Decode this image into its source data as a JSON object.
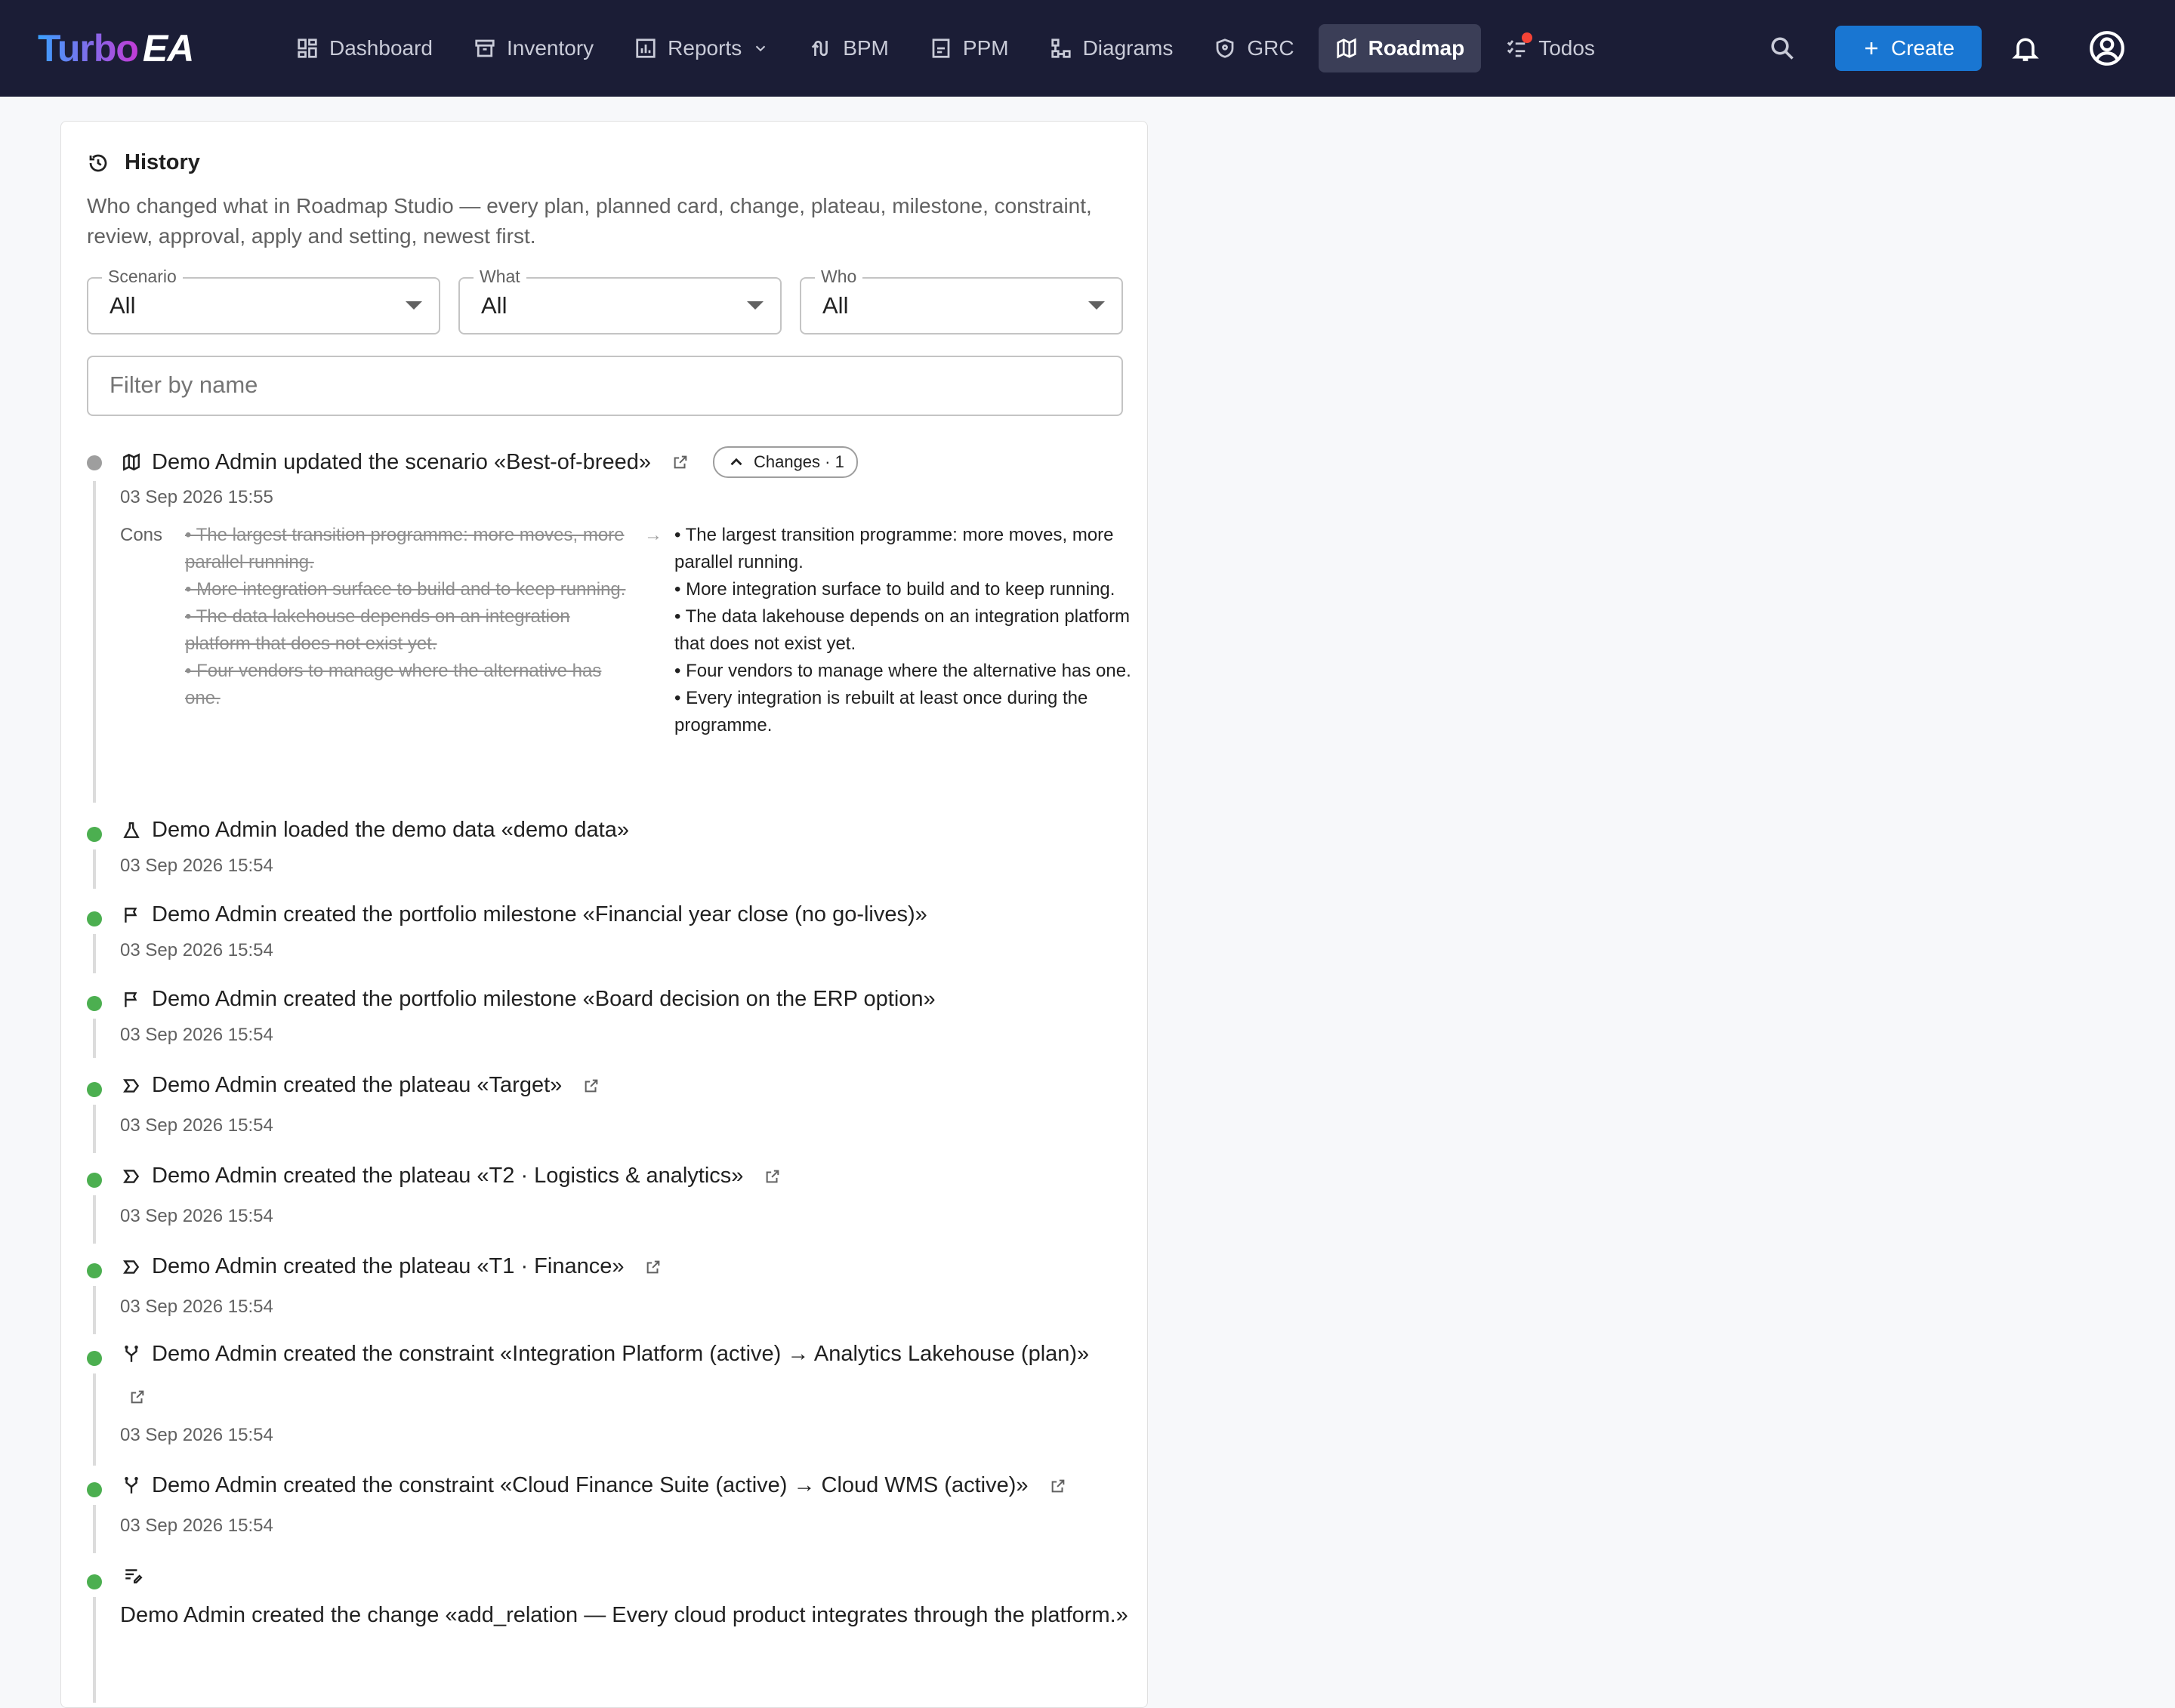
{
  "app": {
    "logo_turbo": "Turbo",
    "logo_ea": "EA"
  },
  "nav": [
    {
      "label": "Dashboard",
      "icon": "dashboard-icon"
    },
    {
      "label": "Inventory",
      "icon": "inventory-icon"
    },
    {
      "label": "Reports",
      "icon": "reports-icon",
      "has_dropdown": true
    },
    {
      "label": "BPM",
      "icon": "bpm-icon"
    },
    {
      "label": "PPM",
      "icon": "ppm-icon"
    },
    {
      "label": "Diagrams",
      "icon": "diagrams-icon"
    },
    {
      "label": "GRC",
      "icon": "grc-icon"
    },
    {
      "label": "Roadmap",
      "icon": "roadmap-icon",
      "active": true
    },
    {
      "label": "Todos",
      "icon": "todos-icon",
      "notification_dot": true
    }
  ],
  "toolbar": {
    "create_label": "Create"
  },
  "colors": {
    "topbar": "#1b1d36",
    "accent": "#1976d2",
    "timeline_dot": "#4caf50",
    "timeline_dot_update": "#9e9e9e",
    "notification": "#f44336"
  },
  "panel": {
    "title": "History",
    "description": "Who changed what in Roadmap Studio — every plan, planned card, change, plateau, milestone, constraint, review, approval, apply and setting, newest first.",
    "filters": {
      "scenario": {
        "label": "Scenario",
        "value": "All"
      },
      "what": {
        "label": "What",
        "value": "All"
      },
      "who": {
        "label": "Who",
        "value": "All"
      }
    },
    "filter_placeholder": "Filter by name"
  },
  "history": [
    {
      "text": "Demo Admin updated the scenario «Best-of-breed»",
      "date": "03 Sep 2026 15:55",
      "icon": "roadmap-icon",
      "changes_chip": "Changes · 1",
      "diff": {
        "field": "Cons",
        "old": [
          "• The largest transition programme: more moves, more parallel running.",
          "• More integration surface to build and to keep running.",
          "• The data lakehouse depends on an integration platform that does not exist yet.",
          "• Four vendors to manage where the alternative has one."
        ],
        "new": [
          "• The largest transition programme: more moves, more parallel running.",
          "• More integration surface to build and to keep running.",
          "• The data lakehouse depends on an integration platform that does not exist yet.",
          "• Four vendors to manage where the alternative has one.",
          "• Every integration is rebuilt at least once during the programme."
        ]
      }
    },
    {
      "text": "Demo Admin loaded the demo data «demo data»",
      "date": "03 Sep 2026 15:54",
      "icon": "flask-icon"
    },
    {
      "text": "Demo Admin created the portfolio milestone «Financial year close (no go-lives)»",
      "date": "03 Sep 2026 15:54",
      "icon": "flag-icon"
    },
    {
      "text": "Demo Admin created the portfolio milestone «Board decision on the ERP option»",
      "date": "03 Sep 2026 15:54",
      "icon": "flag-icon"
    },
    {
      "text": "Demo Admin created the plateau «Target»",
      "date": "03 Sep 2026 15:54",
      "icon": "plateau-icon"
    },
    {
      "text": "Demo Admin created the plateau «T2 · Logistics & analytics»",
      "date": "03 Sep 2026 15:54",
      "icon": "plateau-icon"
    },
    {
      "text": "Demo Admin created the plateau «T1 · Finance»",
      "date": "03 Sep 2026 15:54",
      "icon": "plateau-icon"
    },
    {
      "text": "Demo Admin created the constraint «Integration Platform (active) → Analytics Lakehouse (plan)»",
      "date": "03 Sep 2026 15:54",
      "icon": "constraint-icon"
    },
    {
      "text": "Demo Admin created the constraint «Cloud Finance Suite (active) → Cloud WMS (active)»",
      "date": "03 Sep 2026 15:54",
      "icon": "constraint-icon"
    },
    {
      "text": "Demo Admin created the change «add_relation — Every cloud product integrates through the platform.»",
      "icon": "change-icon"
    }
  ]
}
